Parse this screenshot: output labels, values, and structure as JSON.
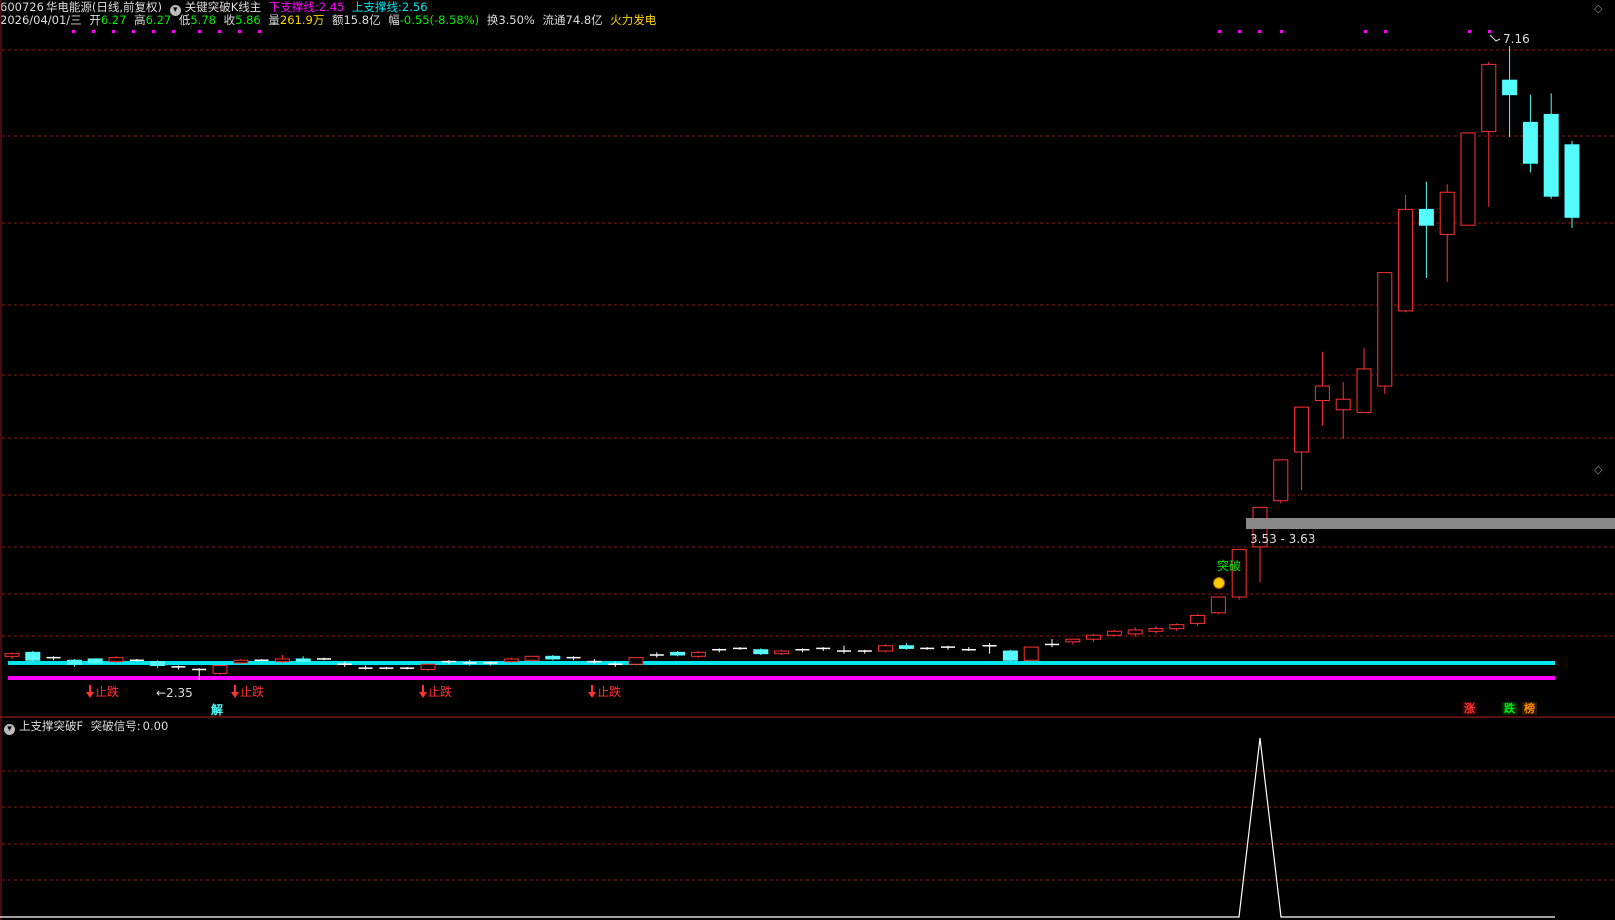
{
  "header": {
    "code": "600726",
    "name": "华电能源",
    "mode": "(日线,前复权)",
    "indicator_name": "关键突破K线主",
    "lower_support_label": "下支撑线:",
    "lower_support_value": "2.45",
    "upper_support_label": "上支撑线:",
    "upper_support_value": "2.56"
  },
  "quote": {
    "date": "2026/04/01/三",
    "open_label": "开",
    "open": "6.27",
    "high_label": "高",
    "high": "6.27",
    "low_label": "低",
    "low": "5.78",
    "close_label": "收",
    "close": "5.86",
    "volume_label": "量",
    "volume": "261.9万",
    "amount_label": "额",
    "amount": "15.8亿",
    "change_label": "幅",
    "change": "-0.55(-8.58%)",
    "turnover_label": "换",
    "turnover": "3.50%",
    "float_label": "流通",
    "float": "74.8亿",
    "sector": "火力发电"
  },
  "annotations": {
    "high_price": "7.16",
    "low_price": "2.35",
    "zone": "3.53 - 3.63",
    "breakout": "突破",
    "stop_fall": "止跌",
    "unlock": "解"
  },
  "footer_badges": [
    "涨",
    "跌",
    "榜"
  ],
  "sub_panel": {
    "indicator_name": "上支撑突破F",
    "signal_label": "突破信号:",
    "signal_value": "0.00"
  },
  "colors": {
    "up": "#ff3232",
    "down": "#54fcfc",
    "upper_line": "#00e5ee",
    "lower_line": "#ff00ff",
    "grid": "#8b1a1a",
    "zone": "#888888"
  },
  "chart_data": {
    "type": "candlestick",
    "price_range": [
      2.3,
      7.3
    ],
    "lines": [
      {
        "name": "上支撑线",
        "value": 2.56
      },
      {
        "name": "下支撑线",
        "value": 2.45
      }
    ],
    "candles": [
      [
        2.53,
        2.55,
        2.51,
        2.56
      ],
      [
        2.56,
        2.5,
        2.49,
        2.57
      ],
      [
        2.52,
        2.52,
        2.5,
        2.53
      ],
      [
        2.5,
        2.47,
        2.45,
        2.51
      ],
      [
        2.51,
        2.48,
        2.47,
        2.51
      ],
      [
        2.49,
        2.52,
        2.48,
        2.53
      ],
      [
        2.5,
        2.5,
        2.49,
        2.51
      ],
      [
        2.49,
        2.46,
        2.44,
        2.5
      ],
      [
        2.45,
        2.45,
        2.43,
        2.46
      ],
      [
        2.42,
        2.43,
        2.35,
        2.44
      ],
      [
        2.4,
        2.46,
        2.39,
        2.46
      ],
      [
        2.48,
        2.5,
        2.47,
        2.51
      ],
      [
        2.5,
        2.5,
        2.49,
        2.51
      ],
      [
        2.49,
        2.51,
        2.48,
        2.54
      ],
      [
        2.51,
        2.49,
        2.48,
        2.53
      ],
      [
        2.51,
        2.51,
        2.5,
        2.52
      ],
      [
        2.47,
        2.46,
        2.45,
        2.49
      ],
      [
        2.44,
        2.44,
        2.43,
        2.46
      ],
      [
        2.44,
        2.44,
        2.43,
        2.45
      ],
      [
        2.44,
        2.44,
        2.43,
        2.45
      ],
      [
        2.43,
        2.47,
        2.42,
        2.47
      ],
      [
        2.49,
        2.48,
        2.47,
        2.5
      ],
      [
        2.48,
        2.48,
        2.46,
        2.5
      ],
      [
        2.48,
        2.47,
        2.46,
        2.49
      ],
      [
        2.49,
        2.51,
        2.48,
        2.52
      ],
      [
        2.5,
        2.53,
        2.49,
        2.53
      ],
      [
        2.53,
        2.51,
        2.5,
        2.54
      ],
      [
        2.52,
        2.52,
        2.5,
        2.53
      ],
      [
        2.49,
        2.49,
        2.47,
        2.51
      ],
      [
        2.46,
        2.47,
        2.45,
        2.49
      ],
      [
        2.47,
        2.52,
        2.46,
        2.52
      ],
      [
        2.53,
        2.54,
        2.52,
        2.56
      ],
      [
        2.56,
        2.54,
        2.53,
        2.57
      ],
      [
        2.53,
        2.56,
        2.52,
        2.57
      ],
      [
        2.57,
        2.58,
        2.56,
        2.59
      ],
      [
        2.59,
        2.59,
        2.58,
        2.6
      ],
      [
        2.58,
        2.55,
        2.54,
        2.59
      ],
      [
        2.55,
        2.57,
        2.54,
        2.58
      ],
      [
        2.58,
        2.58,
        2.56,
        2.59
      ],
      [
        2.58,
        2.59,
        2.57,
        2.6
      ],
      [
        2.57,
        2.56,
        2.55,
        2.61
      ],
      [
        2.57,
        2.57,
        2.55,
        2.58
      ],
      [
        2.57,
        2.61,
        2.56,
        2.62
      ],
      [
        2.61,
        2.59,
        2.58,
        2.63
      ],
      [
        2.59,
        2.58,
        2.58,
        2.6
      ],
      [
        2.6,
        2.6,
        2.58,
        2.61
      ],
      [
        2.58,
        2.58,
        2.57,
        2.6
      ],
      [
        2.61,
        2.61,
        2.55,
        2.63
      ],
      [
        2.57,
        2.5,
        2.49,
        2.58
      ],
      [
        2.5,
        2.6,
        2.5,
        2.6
      ],
      [
        2.62,
        2.62,
        2.6,
        2.66
      ],
      [
        2.64,
        2.66,
        2.62,
        2.66
      ],
      [
        2.66,
        2.69,
        2.64,
        2.7
      ],
      [
        2.69,
        2.72,
        2.68,
        2.73
      ],
      [
        2.7,
        2.73,
        2.68,
        2.75
      ],
      [
        2.72,
        2.74,
        2.7,
        2.76
      ],
      [
        2.74,
        2.77,
        2.72,
        2.78
      ],
      [
        2.78,
        2.84,
        2.76,
        2.85
      ],
      [
        2.86,
        2.98,
        2.85,
        2.98
      ],
      [
        2.98,
        3.34,
        2.96,
        3.34
      ],
      [
        3.36,
        3.66,
        3.09,
        3.66
      ],
      [
        3.71,
        4.02,
        3.69,
        4.02
      ],
      [
        4.08,
        4.42,
        3.79,
        4.42
      ],
      [
        4.47,
        4.58,
        4.28,
        4.84
      ],
      [
        4.4,
        4.48,
        4.18,
        4.61
      ],
      [
        4.38,
        4.71,
        4.39,
        4.87
      ],
      [
        4.58,
        5.44,
        4.52,
        5.44
      ],
      [
        5.15,
        5.92,
        5.14,
        6.03
      ],
      [
        5.92,
        5.8,
        5.4,
        6.13
      ],
      [
        5.73,
        6.05,
        5.37,
        6.11
      ],
      [
        5.8,
        6.5,
        5.87,
        6.5
      ],
      [
        6.51,
        7.02,
        5.94,
        7.04
      ],
      [
        6.9,
        6.79,
        6.47,
        7.16
      ],
      [
        6.58,
        6.27,
        6.2,
        6.79
      ],
      [
        6.64,
        6.02,
        6.0,
        6.8
      ],
      [
        6.41,
        5.86,
        5.78,
        6.44
      ]
    ],
    "signal_series": {
      "name": "突破信号",
      "current": 0.0,
      "spike_index": 60,
      "spike_value": 1
    }
  }
}
